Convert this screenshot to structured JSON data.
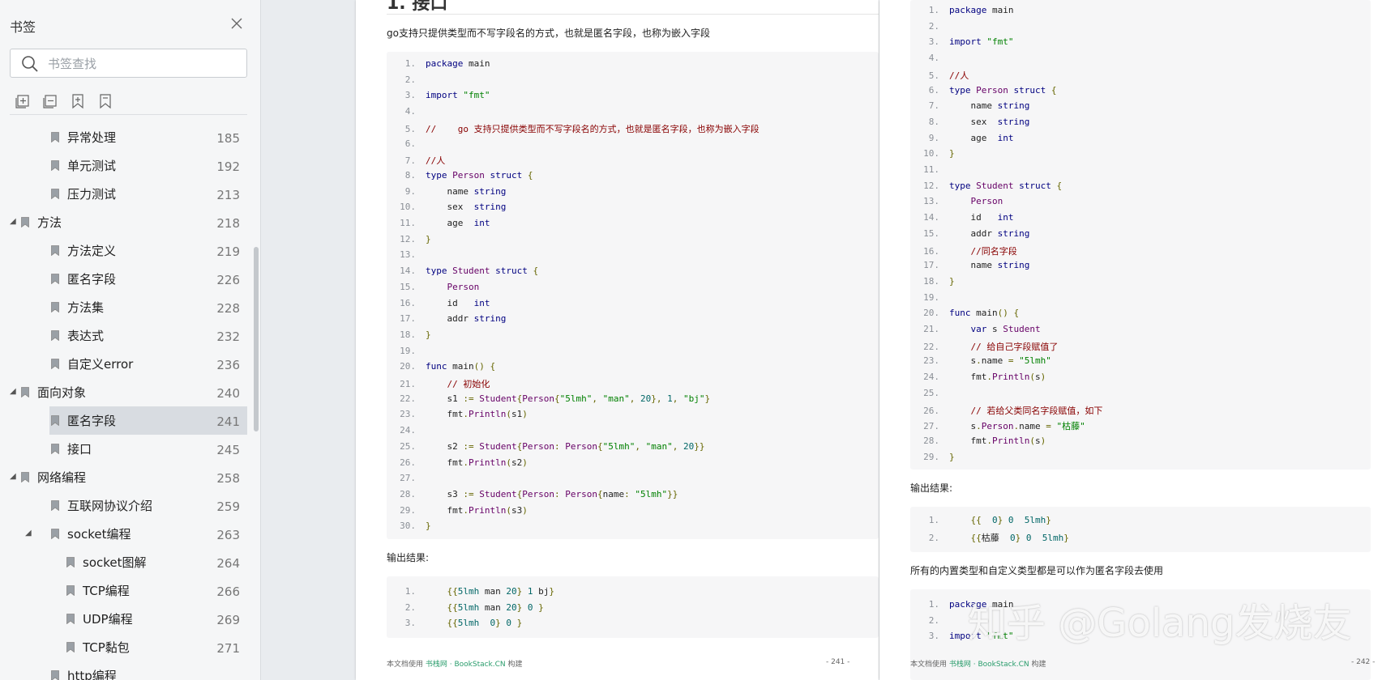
{
  "sidebar": {
    "title": "书签",
    "search_placeholder": "书签查找",
    "tools": [
      "expand-all-icon",
      "collapse-all-icon",
      "add-bookmark-icon",
      "bookmark-icon"
    ],
    "items": [
      {
        "label": "异常处理",
        "page": "185",
        "level": 1,
        "expander": "none",
        "selected": false
      },
      {
        "label": "单元测试",
        "page": "192",
        "level": 1,
        "expander": "none",
        "selected": false
      },
      {
        "label": "压力测试",
        "page": "213",
        "level": 1,
        "expander": "none",
        "selected": false
      },
      {
        "label": "方法",
        "page": "218",
        "level": 0,
        "expander": "open",
        "selected": false
      },
      {
        "label": "方法定义",
        "page": "219",
        "level": 1,
        "expander": "none",
        "selected": false
      },
      {
        "label": "匿名字段",
        "page": "226",
        "level": 1,
        "expander": "none",
        "selected": false
      },
      {
        "label": "方法集",
        "page": "228",
        "level": 1,
        "expander": "none",
        "selected": false
      },
      {
        "label": "表达式",
        "page": "232",
        "level": 1,
        "expander": "none",
        "selected": false
      },
      {
        "label": "自定义error",
        "page": "236",
        "level": 1,
        "expander": "none",
        "selected": false
      },
      {
        "label": "面向对象",
        "page": "240",
        "level": 0,
        "expander": "open",
        "selected": false
      },
      {
        "label": "匿名字段",
        "page": "241",
        "level": 1,
        "expander": "none",
        "selected": true
      },
      {
        "label": "接口",
        "page": "245",
        "level": 1,
        "expander": "none",
        "selected": false
      },
      {
        "label": "网络编程",
        "page": "258",
        "level": 0,
        "expander": "open",
        "selected": false
      },
      {
        "label": "互联网协议介绍",
        "page": "259",
        "level": 1,
        "expander": "none",
        "selected": false
      },
      {
        "label": "socket编程",
        "page": "263",
        "level": 1,
        "expander": "open",
        "selected": false
      },
      {
        "label": "socket图解",
        "page": "264",
        "level": 2,
        "expander": "none",
        "selected": false
      },
      {
        "label": "TCP编程",
        "page": "266",
        "level": 2,
        "expander": "none",
        "selected": false
      },
      {
        "label": "UDP编程",
        "page": "269",
        "level": 2,
        "expander": "none",
        "selected": false
      },
      {
        "label": "TCP黏包",
        "page": "271",
        "level": 2,
        "expander": "none",
        "selected": false
      },
      {
        "label": "http编程",
        "page": "",
        "level": 1,
        "expander": "none",
        "selected": false
      }
    ]
  },
  "page1": {
    "heading": "1.  接口",
    "intro": "go支持只提供类型而不写字段名的方式，也就是匿名字段，也称为嵌入字段",
    "code": [
      [
        [
          "kw",
          "package"
        ],
        [
          "fn",
          " main"
        ]
      ],
      [],
      [
        [
          "kw",
          "import"
        ],
        [
          "fn",
          " "
        ],
        [
          "st",
          "\"fmt\""
        ]
      ],
      [],
      [
        [
          "cm",
          "//    go 支持只提供类型而不写字段名的方式，也就是匿名字段，也称为嵌入字段"
        ]
      ],
      [],
      [
        [
          "cm",
          "//人"
        ]
      ],
      [
        [
          "kw",
          "type"
        ],
        [
          "fn",
          " "
        ],
        [
          "ty",
          "Person"
        ],
        [
          "fn",
          " "
        ],
        [
          "kw",
          "struct"
        ],
        [
          "fn",
          " "
        ],
        [
          "pn",
          "{"
        ]
      ],
      [
        [
          "fn",
          "    name "
        ],
        [
          "kw",
          "string"
        ]
      ],
      [
        [
          "fn",
          "    sex  "
        ],
        [
          "kw",
          "string"
        ]
      ],
      [
        [
          "fn",
          "    age  "
        ],
        [
          "kw",
          "int"
        ]
      ],
      [
        [
          "pn",
          "}"
        ]
      ],
      [],
      [
        [
          "kw",
          "type"
        ],
        [
          "fn",
          " "
        ],
        [
          "ty",
          "Student"
        ],
        [
          "fn",
          " "
        ],
        [
          "kw",
          "struct"
        ],
        [
          "fn",
          " "
        ],
        [
          "pn",
          "{"
        ]
      ],
      [
        [
          "fn",
          "    "
        ],
        [
          "ty",
          "Person"
        ]
      ],
      [
        [
          "fn",
          "    id   "
        ],
        [
          "kw",
          "int"
        ]
      ],
      [
        [
          "fn",
          "    addr "
        ],
        [
          "kw",
          "string"
        ]
      ],
      [
        [
          "pn",
          "}"
        ]
      ],
      [],
      [
        [
          "kw",
          "func"
        ],
        [
          "fn",
          " main"
        ],
        [
          "pn",
          "()"
        ],
        [
          "fn",
          " "
        ],
        [
          "pn",
          "{"
        ]
      ],
      [
        [
          "fn",
          "    "
        ],
        [
          "cm",
          "// 初始化"
        ]
      ],
      [
        [
          "fn",
          "    s1 "
        ],
        [
          "pn",
          ":="
        ],
        [
          "fn",
          " "
        ],
        [
          "ty",
          "Student"
        ],
        [
          "pn",
          "{"
        ],
        [
          "ty",
          "Person"
        ],
        [
          "pn",
          "{"
        ],
        [
          "st",
          "\"5lmh\""
        ],
        [
          "pn",
          ", "
        ],
        [
          "st",
          "\"man\""
        ],
        [
          "pn",
          ", "
        ],
        [
          "nu",
          "20"
        ],
        [
          "pn",
          "}, "
        ],
        [
          "nu",
          "1"
        ],
        [
          "pn",
          ", "
        ],
        [
          "st",
          "\"bj\""
        ],
        [
          "pn",
          "}"
        ]
      ],
      [
        [
          "fn",
          "    fmt"
        ],
        [
          "pn",
          "."
        ],
        [
          "ty",
          "Println"
        ],
        [
          "pn",
          "("
        ],
        [
          "fn",
          "s1"
        ],
        [
          "pn",
          ")"
        ]
      ],
      [],
      [
        [
          "fn",
          "    s2 "
        ],
        [
          "pn",
          ":="
        ],
        [
          "fn",
          " "
        ],
        [
          "ty",
          "Student"
        ],
        [
          "pn",
          "{"
        ],
        [
          "ty",
          "Person"
        ],
        [
          "pn",
          ": "
        ],
        [
          "ty",
          "Person"
        ],
        [
          "pn",
          "{"
        ],
        [
          "st",
          "\"5lmh\""
        ],
        [
          "pn",
          ", "
        ],
        [
          "st",
          "\"man\""
        ],
        [
          "pn",
          ", "
        ],
        [
          "nu",
          "20"
        ],
        [
          "pn",
          "}}"
        ]
      ],
      [
        [
          "fn",
          "    fmt"
        ],
        [
          "pn",
          "."
        ],
        [
          "ty",
          "Println"
        ],
        [
          "pn",
          "("
        ],
        [
          "fn",
          "s2"
        ],
        [
          "pn",
          ")"
        ]
      ],
      [],
      [
        [
          "fn",
          "    s3 "
        ],
        [
          "pn",
          ":="
        ],
        [
          "fn",
          " "
        ],
        [
          "ty",
          "Student"
        ],
        [
          "pn",
          "{"
        ],
        [
          "ty",
          "Person"
        ],
        [
          "pn",
          ": "
        ],
        [
          "ty",
          "Person"
        ],
        [
          "pn",
          "{"
        ],
        [
          "fn",
          "name"
        ],
        [
          "pn",
          ": "
        ],
        [
          "st",
          "\"5lmh\""
        ],
        [
          "pn",
          "}}"
        ]
      ],
      [
        [
          "fn",
          "    fmt"
        ],
        [
          "pn",
          "."
        ],
        [
          "ty",
          "Println"
        ],
        [
          "pn",
          "("
        ],
        [
          "fn",
          "s3"
        ],
        [
          "pn",
          ")"
        ]
      ],
      [
        [
          "pn",
          "}"
        ]
      ]
    ],
    "output_label": "输出结果:",
    "output": [
      [
        [
          "fn",
          "    "
        ],
        [
          "pn",
          "{{"
        ],
        [
          "nu",
          "5lmh"
        ],
        [
          "fn",
          " man "
        ],
        [
          "nu",
          "20"
        ],
        [
          "pn",
          "}"
        ],
        [
          "fn",
          " "
        ],
        [
          "nu",
          "1"
        ],
        [
          "fn",
          " bj"
        ],
        [
          "pn",
          "}"
        ]
      ],
      [
        [
          "fn",
          "    "
        ],
        [
          "pn",
          "{{"
        ],
        [
          "nu",
          "5lmh"
        ],
        [
          "fn",
          " man "
        ],
        [
          "nu",
          "20"
        ],
        [
          "pn",
          "}"
        ],
        [
          "fn",
          " "
        ],
        [
          "nu",
          "0"
        ],
        [
          "fn",
          " "
        ],
        [
          "pn",
          "}"
        ]
      ],
      [
        [
          "fn",
          "    "
        ],
        [
          "pn",
          "{{"
        ],
        [
          "nu",
          "5lmh"
        ],
        [
          "fn",
          "  "
        ],
        [
          "nu",
          "0"
        ],
        [
          "pn",
          "}"
        ],
        [
          "fn",
          " "
        ],
        [
          "nu",
          "0"
        ],
        [
          "fn",
          " "
        ],
        [
          "pn",
          "}"
        ]
      ]
    ],
    "footer_prefix": "本文档使用 ",
    "footer_brand": "书栈网 · BookStack.CN",
    "footer_suffix": " 构建",
    "page_number": "- 241 -"
  },
  "page2": {
    "code": [
      [
        [
          "kw",
          "package"
        ],
        [
          "fn",
          " main"
        ]
      ],
      [],
      [
        [
          "kw",
          "import"
        ],
        [
          "fn",
          " "
        ],
        [
          "st",
          "\"fmt\""
        ]
      ],
      [],
      [
        [
          "cm",
          "//人"
        ]
      ],
      [
        [
          "kw",
          "type"
        ],
        [
          "fn",
          " "
        ],
        [
          "ty",
          "Person"
        ],
        [
          "fn",
          " "
        ],
        [
          "kw",
          "struct"
        ],
        [
          "fn",
          " "
        ],
        [
          "pn",
          "{"
        ]
      ],
      [
        [
          "fn",
          "    name "
        ],
        [
          "kw",
          "string"
        ]
      ],
      [
        [
          "fn",
          "    sex  "
        ],
        [
          "kw",
          "string"
        ]
      ],
      [
        [
          "fn",
          "    age  "
        ],
        [
          "kw",
          "int"
        ]
      ],
      [
        [
          "pn",
          "}"
        ]
      ],
      [],
      [
        [
          "kw",
          "type"
        ],
        [
          "fn",
          " "
        ],
        [
          "ty",
          "Student"
        ],
        [
          "fn",
          " "
        ],
        [
          "kw",
          "struct"
        ],
        [
          "fn",
          " "
        ],
        [
          "pn",
          "{"
        ]
      ],
      [
        [
          "fn",
          "    "
        ],
        [
          "ty",
          "Person"
        ]
      ],
      [
        [
          "fn",
          "    id   "
        ],
        [
          "kw",
          "int"
        ]
      ],
      [
        [
          "fn",
          "    addr "
        ],
        [
          "kw",
          "string"
        ]
      ],
      [
        [
          "fn",
          "    "
        ],
        [
          "cm",
          "//同名字段"
        ]
      ],
      [
        [
          "fn",
          "    name "
        ],
        [
          "kw",
          "string"
        ]
      ],
      [
        [
          "pn",
          "}"
        ]
      ],
      [],
      [
        [
          "kw",
          "func"
        ],
        [
          "fn",
          " main"
        ],
        [
          "pn",
          "()"
        ],
        [
          "fn",
          " "
        ],
        [
          "pn",
          "{"
        ]
      ],
      [
        [
          "fn",
          "    "
        ],
        [
          "kw",
          "var"
        ],
        [
          "fn",
          " s "
        ],
        [
          "ty",
          "Student"
        ]
      ],
      [
        [
          "fn",
          "    "
        ],
        [
          "cm",
          "// 给自己字段赋值了"
        ]
      ],
      [
        [
          "fn",
          "    s"
        ],
        [
          "pn",
          "."
        ],
        [
          "fn",
          "name "
        ],
        [
          "pn",
          "="
        ],
        [
          "fn",
          " "
        ],
        [
          "st",
          "\"5lmh\""
        ]
      ],
      [
        [
          "fn",
          "    fmt"
        ],
        [
          "pn",
          "."
        ],
        [
          "ty",
          "Println"
        ],
        [
          "pn",
          "("
        ],
        [
          "fn",
          "s"
        ],
        [
          "pn",
          ")"
        ]
      ],
      [],
      [
        [
          "fn",
          "    "
        ],
        [
          "cm",
          "// 若给父类同名字段赋值，如下"
        ]
      ],
      [
        [
          "fn",
          "    s"
        ],
        [
          "pn",
          "."
        ],
        [
          "ty",
          "Person"
        ],
        [
          "pn",
          "."
        ],
        [
          "fn",
          "name "
        ],
        [
          "pn",
          "="
        ],
        [
          "fn",
          " "
        ],
        [
          "st",
          "\"枯藤\""
        ]
      ],
      [
        [
          "fn",
          "    fmt"
        ],
        [
          "pn",
          "."
        ],
        [
          "ty",
          "Println"
        ],
        [
          "pn",
          "("
        ],
        [
          "fn",
          "s"
        ],
        [
          "pn",
          ")"
        ]
      ],
      [
        [
          "pn",
          "}"
        ]
      ]
    ],
    "output_label": "输出结果:",
    "output": [
      [
        [
          "fn",
          "    "
        ],
        [
          "pn",
          "{{"
        ],
        [
          "fn",
          "  "
        ],
        [
          "nu",
          "0"
        ],
        [
          "pn",
          "}"
        ],
        [
          "fn",
          " "
        ],
        [
          "nu",
          "0"
        ],
        [
          "fn",
          "  "
        ],
        [
          "nu",
          "5lmh"
        ],
        [
          "pn",
          "}"
        ]
      ],
      [
        [
          "fn",
          "    "
        ],
        [
          "pn",
          "{{"
        ],
        [
          "fn",
          "枯藤  "
        ],
        [
          "nu",
          "0"
        ],
        [
          "pn",
          "}"
        ],
        [
          "fn",
          " "
        ],
        [
          "nu",
          "0"
        ],
        [
          "fn",
          "  "
        ],
        [
          "nu",
          "5lmh"
        ],
        [
          "pn",
          "}"
        ]
      ]
    ],
    "note": "所有的内置类型和自定义类型都是可以作为匿名字段去使用",
    "code2": [
      [
        [
          "kw",
          "package"
        ],
        [
          "fn",
          " main"
        ]
      ],
      [],
      [
        [
          "kw",
          "import"
        ],
        [
          "fn",
          " "
        ],
        [
          "st",
          "\"fmt\""
        ]
      ]
    ],
    "footer_prefix": "本文档使用 ",
    "footer_brand": "书栈网 · BookStack.CN",
    "footer_suffix": " 构建",
    "page_number": "- 242 -"
  },
  "watermark": "知乎 @Golang发烧友"
}
